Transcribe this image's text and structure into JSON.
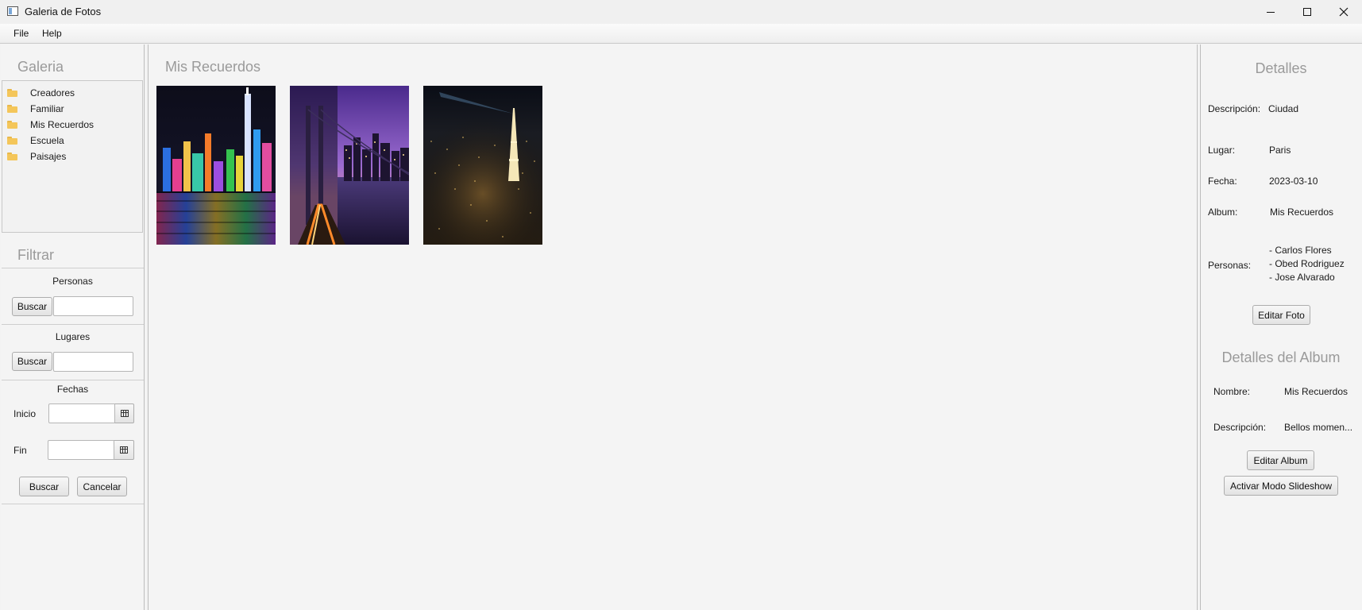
{
  "window": {
    "title": "Galeria de Fotos"
  },
  "menu": {
    "items": [
      "File",
      "Help"
    ]
  },
  "gallery": {
    "title": "Galeria",
    "albums": [
      "Creadores",
      "Familiar",
      "Mis Recuerdos",
      "Escuela",
      "Paisajes"
    ]
  },
  "filter": {
    "title": "Filtrar",
    "people": {
      "label": "Personas",
      "button": "Buscar",
      "value": ""
    },
    "places": {
      "label": "Lugares",
      "button": "Buscar",
      "value": ""
    },
    "dates": {
      "label": "Fechas",
      "start_label": "Inicio",
      "end_label": "Fin",
      "start_value": "",
      "end_value": "",
      "search_button": "Buscar",
      "cancel_button": "Cancelar"
    }
  },
  "main": {
    "album_title": "Mis Recuerdos",
    "photos": [
      {
        "name": "hong-kong-skyline-photo",
        "icon": "city-night-photo"
      },
      {
        "name": "bay-bridge-city-photo",
        "icon": "bridge-night-photo"
      },
      {
        "name": "paris-eiffel-night-photo",
        "icon": "eiffel-night-photo"
      }
    ]
  },
  "details": {
    "title": "Detalles",
    "description_label": "Descripción:",
    "description_value": "Ciudad",
    "place_label": "Lugar:",
    "place_value": "Paris",
    "date_label": "Fecha:",
    "date_value": "2023-03-10",
    "album_label": "Album:",
    "album_value": "Mis Recuerdos",
    "people_label": "Personas:",
    "people": [
      "- Carlos Flores",
      "- Obed Rodriguez",
      "- Jose Alvarado"
    ],
    "edit_photo_button": "Editar Foto"
  },
  "album_details": {
    "title": "Detalles del Album",
    "name_label": "Nombre:",
    "name_value": "Mis Recuerdos",
    "description_label": "Descripción:",
    "description_value": "Bellos momen...",
    "edit_album_button": "Editar Album",
    "slideshow_button": "Activar Modo Slideshow"
  },
  "colors": {
    "background": "#f3f3f3",
    "heading_gray": "#9a9a9a",
    "folder": "#f4c65a",
    "border": "#bdbdbd"
  }
}
